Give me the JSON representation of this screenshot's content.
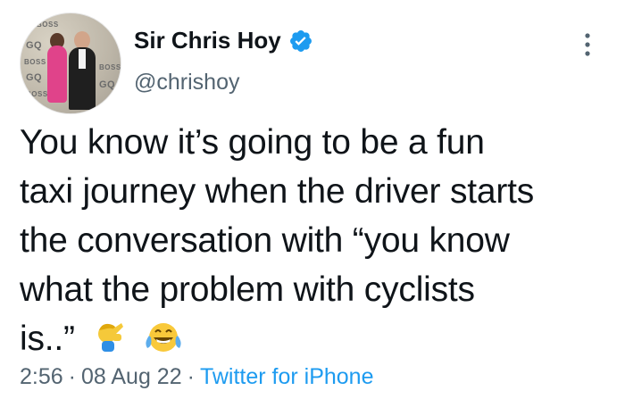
{
  "author": {
    "display_name": "Sir Chris Hoy",
    "handle": "@chrishoy",
    "verified": true,
    "avatar_background_text": [
      "BOSS",
      "GQ",
      "BOSS",
      "GQ",
      "BOSS",
      "GQ",
      "BOSS"
    ]
  },
  "tweet": {
    "text_line_1": "You know it’s going to be a fun",
    "text_line_2": "taxi journey when the driver starts",
    "text_line_3": "the conversation with “you know",
    "text_line_4": "what the problem with cyclists",
    "text_line_5": "is..”",
    "emojis": [
      "facepalm-icon",
      "tears-of-joy-icon"
    ]
  },
  "meta": {
    "time": "2:56",
    "separator": "·",
    "date": "08 Aug 22",
    "source": "Twitter for iPhone"
  },
  "colors": {
    "text": "#0f1419",
    "secondary": "#536471",
    "accent": "#1d9bf0"
  }
}
